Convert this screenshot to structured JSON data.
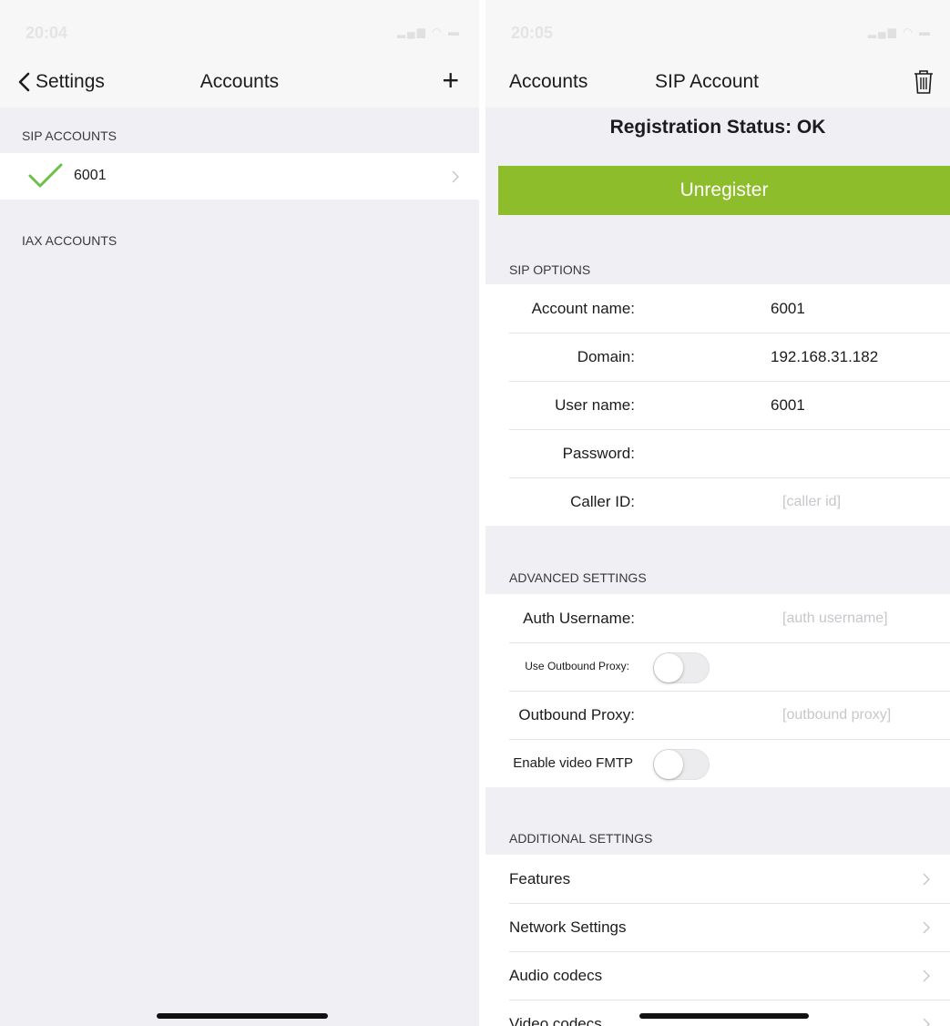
{
  "left": {
    "status_time": "20:04",
    "nav": {
      "back_label": "Settings",
      "title": "Accounts",
      "add_label": "+"
    },
    "sections": {
      "sip": "SIP ACCOUNTS",
      "iax": "IAX ACCOUNTS"
    },
    "accounts": [
      {
        "name": "6001",
        "registered": true
      }
    ]
  },
  "right": {
    "status_time": "20:05",
    "nav": {
      "back_label": "Accounts",
      "title": "SIP Account"
    },
    "registration_status": "Registration Status: OK",
    "unregister_label": "Unregister",
    "sip_options": {
      "header": "SIP OPTIONS",
      "rows": [
        {
          "label": "Account name:",
          "value": "6001"
        },
        {
          "label": "Domain:",
          "value": "192.168.31.182"
        },
        {
          "label": "User name:",
          "value": "6001"
        },
        {
          "label": "Password:",
          "value": ""
        },
        {
          "label": "Caller ID:",
          "placeholder": "[caller id]"
        }
      ]
    },
    "advanced": {
      "header": "ADVANCED SETTINGS",
      "auth_username": {
        "label": "Auth Username:",
        "placeholder": "[auth username]"
      },
      "use_outbound_proxy": {
        "label": "Use Outbound Proxy:",
        "enabled": false
      },
      "outbound_proxy": {
        "label": "Outbound Proxy:",
        "placeholder": "[outbound proxy]"
      },
      "enable_video_fmtp": {
        "label": "Enable video FMTP",
        "enabled": false
      }
    },
    "additional": {
      "header": "ADDITIONAL SETTINGS",
      "items": [
        "Features",
        "Network Settings",
        "Audio codecs",
        "Video codecs"
      ]
    }
  },
  "colors": {
    "accent_green": "#8dbd2a",
    "check_green": "#6cc04a",
    "background": "#efeff4"
  }
}
